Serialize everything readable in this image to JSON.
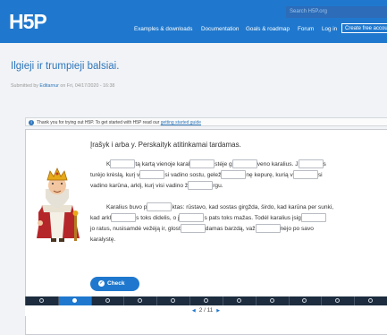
{
  "header": {
    "logo": "H5P",
    "search_placeholder": "Search H5P.org",
    "nav": [
      "Examples & downloads",
      "Documentation",
      "Goals & roadmap",
      "Forum",
      "Log in"
    ],
    "create_account": "Create free account",
    "brand_color": "#1f78ce"
  },
  "page": {
    "title": "Ilgieji ir trumpieji balsiai.",
    "submitted_prefix": "Submitted by",
    "author": "Editarnur",
    "submitted_suffix": "on Fri, 04/17/2020 - 16:38",
    "notice_text": "Thank you for trying out H5P. To get started with H5P read our",
    "notice_link": "getting started guide"
  },
  "task": {
    "title": "Įrašyk i arba y. Perskaityk atitinkamai tardamas.",
    "p1": {
      "line1": [
        "K",
        "tą kartą vienoje karal",
        "stėje g",
        "veno karalius. J",
        "s"
      ],
      "line2": [
        "turėjo krėslą, kurį v",
        "si vadino sostu, gelež",
        "nę kepurę, kurią v",
        "si"
      ],
      "line3": [
        "vadino karūna, arklį, kurį visi vadino ž",
        "rgu."
      ]
    },
    "p2": {
      "line1": [
        "Karalius buvo p",
        "ktas: rūstavo, kad sostas girgždа, širdo, kad karūna per sunki,"
      ],
      "line2": [
        "kad arkl",
        "s toks didelis, o j",
        "s pats toks mažas. Todėl karalius įsig"
      ],
      "line3": [
        "jo ratus, nusisamdė vežėją ir, glost",
        "damas barzdą, važ",
        "nėjo po savo"
      ],
      "line4": [
        "karalystę."
      ]
    },
    "check_label": "Check"
  },
  "progress": {
    "current": 2,
    "total": 11,
    "label": "2 / 11"
  }
}
